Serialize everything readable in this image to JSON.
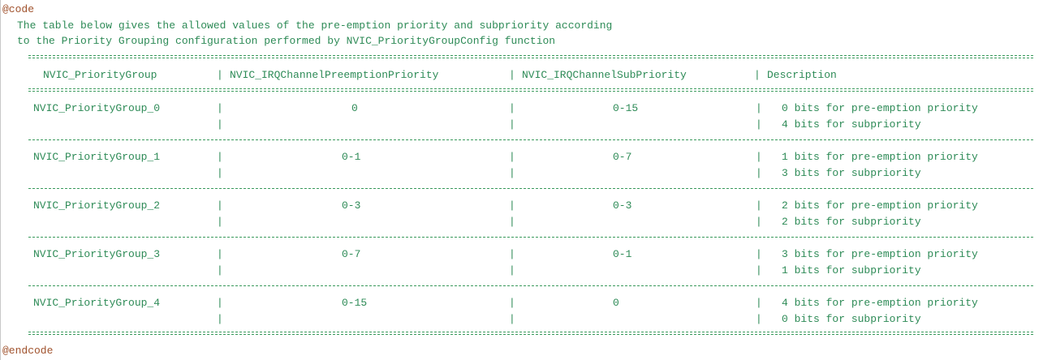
{
  "code_open": "@code",
  "code_close": "@endcode",
  "intro": [
    "The table below gives the allowed values of the pre-emption priority and subpriority according",
    "to the Priority Grouping configuration performed by NVIC_PriorityGroupConfig function"
  ],
  "headers": {
    "group": "NVIC_PriorityGroup",
    "preemption": "NVIC_IRQChannelPreemptionPriority",
    "sub": "NVIC_IRQChannelSubPriority",
    "desc": "Description"
  },
  "rows": [
    {
      "group": "NVIC_PriorityGroup_0",
      "preemption": "0",
      "sub": "0-15",
      "desc1": "0 bits for pre-emption priority",
      "desc2": "4 bits for subpriority"
    },
    {
      "group": "NVIC_PriorityGroup_1",
      "preemption": "0-1",
      "sub": "0-7",
      "desc1": "1 bits for pre-emption priority",
      "desc2": "3 bits for subpriority"
    },
    {
      "group": "NVIC_PriorityGroup_2",
      "preemption": "0-3",
      "sub": "0-3",
      "desc1": "2 bits for pre-emption priority",
      "desc2": "2 bits for subpriority"
    },
    {
      "group": "NVIC_PriorityGroup_3",
      "preemption": "0-7",
      "sub": "0-1",
      "desc1": "3 bits for pre-emption priority",
      "desc2": "1 bits for subpriority"
    },
    {
      "group": "NVIC_PriorityGroup_4",
      "preemption": "0-15",
      "sub": "0",
      "desc1": "4 bits for pre-emption priority",
      "desc2": "0 bits for subpriority"
    }
  ],
  "separator": "|",
  "colors": {
    "comment": "#2e8b57",
    "tag": "#a0522d"
  }
}
